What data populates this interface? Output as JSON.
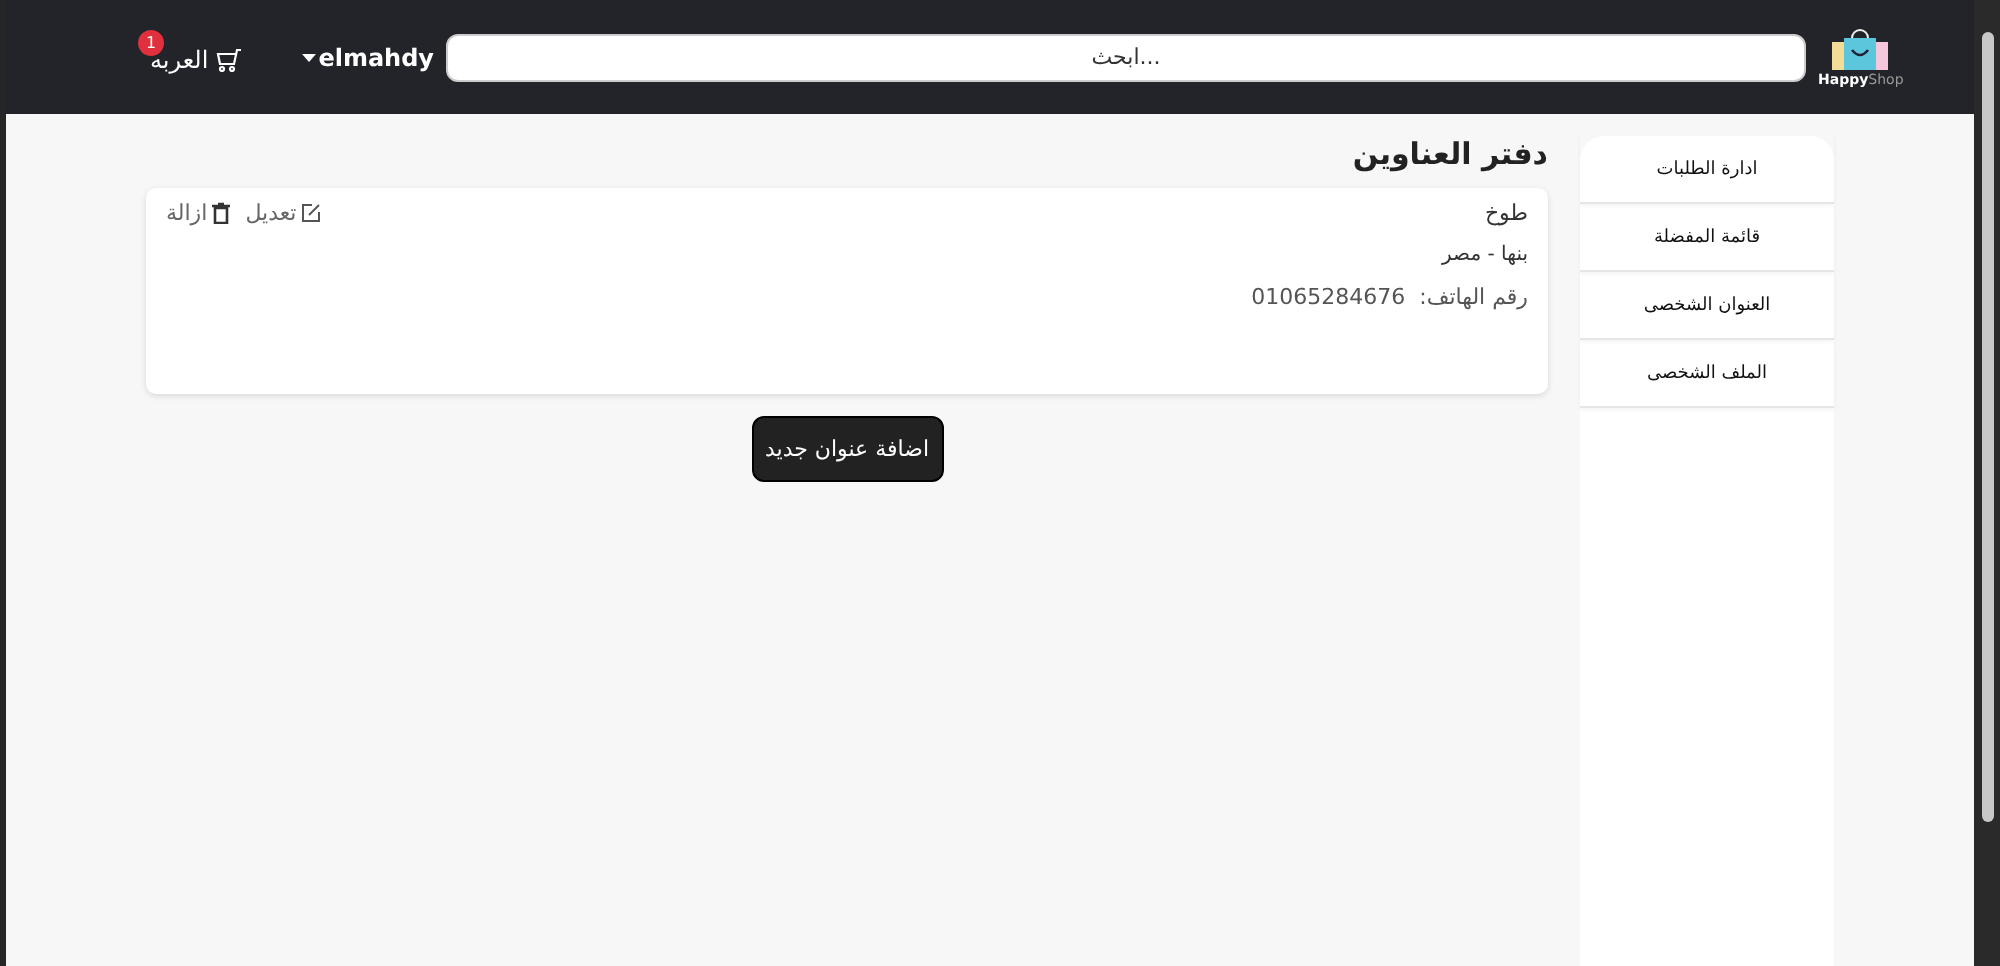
{
  "header": {
    "logo": {
      "word1": "Happy",
      "word2": "Shop"
    },
    "search": {
      "placeholder": "ابحث..."
    },
    "user": {
      "name": "elmahdy"
    },
    "cart": {
      "label": "العربه",
      "count": "1"
    }
  },
  "sidebar": {
    "items": [
      {
        "label": "ادارة الطلبات"
      },
      {
        "label": "قائمة المفضلة"
      },
      {
        "label": "العنوان الشخصى"
      },
      {
        "label": "الملف الشخصى"
      }
    ]
  },
  "main": {
    "title": "دفتر العناوين",
    "addresses": [
      {
        "name": "طوخ",
        "location": "بنها - مصر",
        "phone_label": "رقم الهاتف:",
        "phone": "01065284676",
        "edit": "تعديل",
        "remove": "ازالة"
      }
    ],
    "add_button": "اضافة عنوان جديد"
  }
}
